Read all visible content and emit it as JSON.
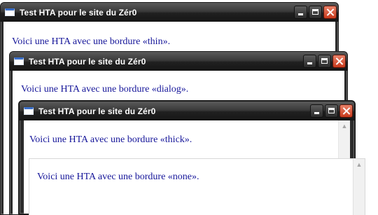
{
  "windows": [
    {
      "title": "Test HTA pour le site du Zér0",
      "text": "Voici une HTA avec une bordure «thin»."
    },
    {
      "title": "Test HTA pour le site du Zér0",
      "text": "Voici une HTA avec une bordure «dialog»."
    },
    {
      "title": "Test HTA pour le site du Zér0",
      "text": "Voici une HTA avec une bordure «thick»."
    },
    {
      "title": "",
      "text": "Voici une HTA avec une bordure «none»."
    }
  ]
}
